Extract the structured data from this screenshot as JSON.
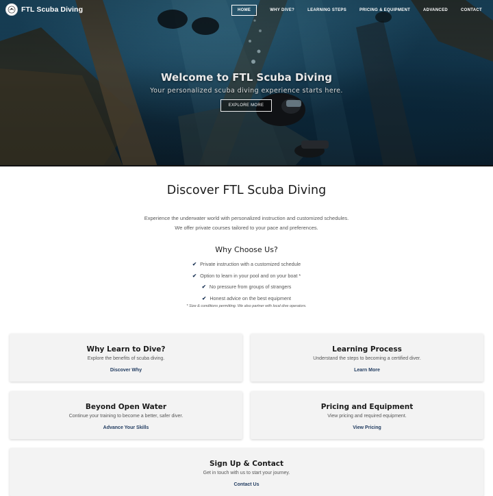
{
  "nav": {
    "brand": "FTL Scuba Diving",
    "items": [
      {
        "label": "HOME",
        "active": true
      },
      {
        "label": "WHY DIVE?"
      },
      {
        "label": "LEARNING STEPS"
      },
      {
        "label": "PRICING & EQUIPMENT"
      },
      {
        "label": "ADVANCED"
      },
      {
        "label": "CONTACT"
      }
    ]
  },
  "hero": {
    "title": "Welcome to FTL Scuba Diving",
    "subtitle": "Your personalized scuba diving experience starts here.",
    "button": "EXPLORE MORE"
  },
  "about": {
    "title": "Discover FTL Scuba Diving",
    "lines": [
      "Experience the underwater world with personalized instruction and customized schedules.",
      "We offer private courses tailored to your pace and preferences."
    ]
  },
  "why": {
    "title": "Why Choose Us?",
    "check_icon": "check-icon",
    "items": [
      "Private instruction with a customized schedule",
      "Option to learn in your pool and on your boat *",
      "No pressure from groups of strangers",
      "Honest advice on the best equipment"
    ],
    "note": "* Size & conditions permitting. We also partner with local dive operators."
  },
  "cards": [
    {
      "title": "Why Learn to Dive?",
      "desc": "Explore the benefits of scuba diving.",
      "link": "Discover Why"
    },
    {
      "title": "Learning Process",
      "desc": "Understand the steps to becoming a certified diver.",
      "link": "Learn More"
    },
    {
      "title": "Beyond Open Water",
      "desc": "Continue your training to become a better, safer diver.",
      "link": "Advance Your Skills"
    },
    {
      "title": "Pricing and Equipment",
      "desc": "View pricing and required equipment.",
      "link": "View Pricing"
    },
    {
      "title": "Sign Up & Contact",
      "desc": "Get in touch with us to start your journey.",
      "link": "Contact Us"
    }
  ],
  "colors": {
    "accent": "#1f3a5f",
    "card_bg": "#f3f3f3"
  }
}
